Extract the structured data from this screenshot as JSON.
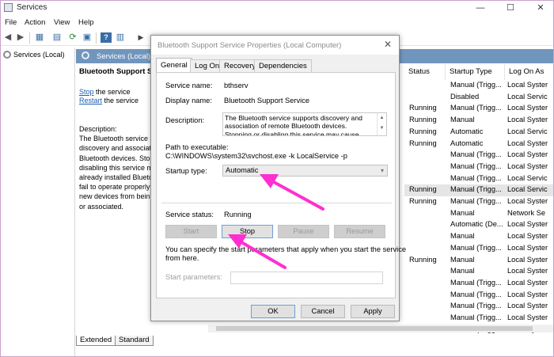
{
  "window": {
    "title": "Services",
    "controls": {
      "minimize": "—",
      "maximize": "☐",
      "close": "✕"
    }
  },
  "menu": [
    "File",
    "Action",
    "View",
    "Help"
  ],
  "tree": {
    "root_label": "Services (Local)"
  },
  "pane": {
    "header_title": "Services (Local)",
    "selected_service_title": "Bluetooth Support Se",
    "stop_link": "Stop",
    "stop_suffix": " the service",
    "restart_link": "Restart",
    "restart_suffix": " the service",
    "description_lines": [
      "Description:",
      "The Bluetooth service s",
      "discovery and associati",
      "Bluetooth devices.  Sto",
      "disabling this service m",
      "already installed Blueto",
      "fail to operate properly",
      "new devices from bein",
      "or associated."
    ]
  },
  "list": {
    "columns": [
      "Status",
      "Startup Type",
      "Log On As"
    ],
    "rows": [
      {
        "status": "",
        "startup": "Manual (Trigg...",
        "logon": "Local Syster"
      },
      {
        "status": "",
        "startup": "Disabled",
        "logon": "Local Servic"
      },
      {
        "status": "Running",
        "startup": "Manual (Trigg...",
        "logon": "Local Syster"
      },
      {
        "status": "Running",
        "startup": "Manual",
        "logon": "Local Syster"
      },
      {
        "status": "Running",
        "startup": "Automatic",
        "logon": "Local Servic"
      },
      {
        "status": "Running",
        "startup": "Automatic",
        "logon": "Local Syster"
      },
      {
        "status": "",
        "startup": "Manual (Trigg...",
        "logon": "Local Syster"
      },
      {
        "status": "",
        "startup": "Manual (Trigg...",
        "logon": "Local Syster"
      },
      {
        "status": "",
        "startup": "Manual (Trigg...",
        "logon": "Local Servic"
      },
      {
        "status": "Running",
        "startup": "Manual (Trigg...",
        "logon": "Local Servic",
        "selected": true
      },
      {
        "status": "Running",
        "startup": "Manual (Trigg...",
        "logon": "Local Syster"
      },
      {
        "status": "",
        "startup": "Manual",
        "logon": "Network Se"
      },
      {
        "status": "",
        "startup": "Automatic (De...",
        "logon": "Local Syster"
      },
      {
        "status": "",
        "startup": "Manual",
        "logon": "Local Syster"
      },
      {
        "status": "",
        "startup": "Manual (Trigg...",
        "logon": "Local Syster"
      },
      {
        "status": "Running",
        "startup": "Manual",
        "logon": "Local Syster"
      },
      {
        "status": "",
        "startup": "Manual",
        "logon": "Local Syster"
      },
      {
        "status": "",
        "startup": "Manual (Trigg...",
        "logon": "Local Syster"
      },
      {
        "status": "",
        "startup": "Manual (Trigg...",
        "logon": "Local Syster"
      },
      {
        "status": "",
        "startup": "Manual (Trigg...",
        "logon": "Local Syster"
      },
      {
        "status": "",
        "startup": "Manual (Trigg...",
        "logon": "Local Syster"
      },
      {
        "status": "",
        "startup": "Manual (Trigg...",
        "logon": "Local Syster"
      }
    ]
  },
  "bottom_tabs": [
    "Extended",
    "Standard"
  ],
  "dialog": {
    "title": "Bluetooth Support Service Properties (Local Computer)",
    "tabs": [
      "General",
      "Log On",
      "Recovery",
      "Dependencies"
    ],
    "service_name_label": "Service name:",
    "service_name": "bthserv",
    "display_name_label": "Display name:",
    "display_name": "Bluetooth Support Service",
    "description_label": "Description:",
    "description": "The Bluetooth service supports discovery and association of remote Bluetooth devices.  Stopping or disabling this service may cause already installed",
    "path_label": "Path to executable:",
    "path": "C:\\WINDOWS\\system32\\svchost.exe -k LocalService -p",
    "startup_type_label": "Startup type:",
    "startup_type": "Automatic",
    "service_status_label": "Service status:",
    "service_status": "Running",
    "buttons": {
      "start": "Start",
      "stop": "Stop",
      "pause": "Pause",
      "resume": "Resume"
    },
    "hint_line1": "You can specify the start parameters that apply when you start the service",
    "hint_line2": "from here.",
    "start_params_label": "Start parameters:",
    "start_params_value": "",
    "ok": "OK",
    "cancel": "Cancel",
    "apply": "Apply"
  },
  "colors": {
    "accent_pane_header": "#7196bd",
    "annotation_arrow": "#ff2fd0",
    "link": "#1a5fb4"
  }
}
